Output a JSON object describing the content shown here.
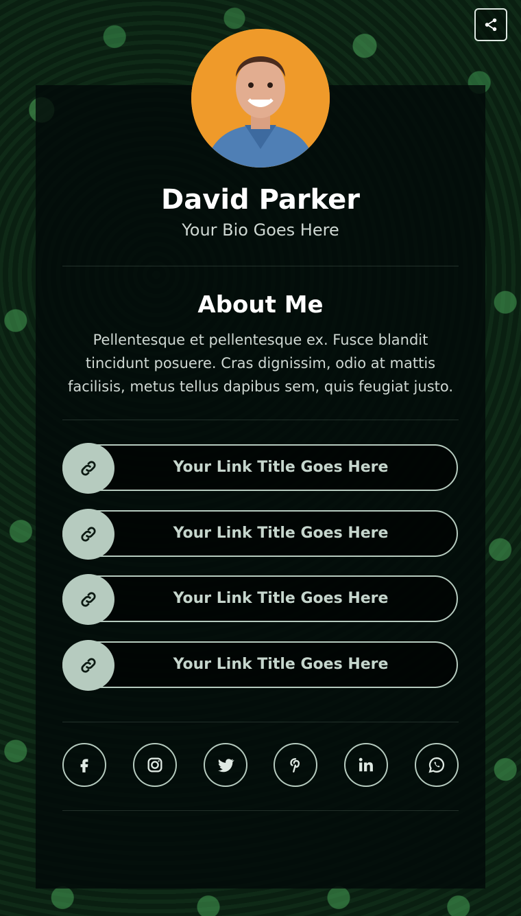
{
  "profile": {
    "name": "David Parker",
    "bio": "Your Bio Goes Here",
    "avatar_bg": "#ef9a2a"
  },
  "about": {
    "title": "About Me",
    "text": "Pellentesque et pellentesque ex. Fusce blandit tincidunt posuere. Cras dignissim, odio at mattis facilisis, metus tellus dapibus sem, quis feugiat justo."
  },
  "links": [
    {
      "label": "Your Link Title Goes Here",
      "icon": "link-icon"
    },
    {
      "label": "Your Link Title Goes Here",
      "icon": "link-icon"
    },
    {
      "label": "Your Link Title Goes Here",
      "icon": "link-icon"
    },
    {
      "label": "Your Link Title Goes Here",
      "icon": "link-icon"
    }
  ],
  "socials": [
    {
      "icon": "facebook-icon"
    },
    {
      "icon": "instagram-icon"
    },
    {
      "icon": "twitter-icon"
    },
    {
      "icon": "pinterest-icon"
    },
    {
      "icon": "linkedin-icon"
    },
    {
      "icon": "whatsapp-icon"
    }
  ],
  "theme": {
    "accent": "#b6cbbf",
    "card_bg": "#030a08"
  }
}
